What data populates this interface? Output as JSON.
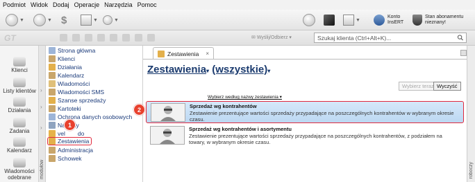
{
  "menu": [
    "Podmiot",
    "Widok",
    "Dodaj",
    "Operacje",
    "Narzędzia",
    "Pomoc"
  ],
  "account": {
    "title": "Konto",
    "name": "InsERT",
    "subscription_line1": "Stan abonamentu",
    "subscription_line2": "nieznany!"
  },
  "subbar": {
    "logo": "GT",
    "send_label": "Wyślij/Odbierz",
    "search_placeholder": "Szukaj klienta (Ctrl+Alt+K)..."
  },
  "left_nav": [
    {
      "label": "Klienci",
      "icon": "clients-icon"
    },
    {
      "label": "Listy klientów",
      "icon": "client-lists-icon"
    },
    {
      "label": "Działania",
      "icon": "actions-icon"
    },
    {
      "label": "Zadania",
      "icon": "tasks-icon"
    },
    {
      "label": "Kalendarz",
      "icon": "calendar-icon"
    },
    {
      "label": "Wiadomości odebrane",
      "icon": "inbox-icon"
    }
  ],
  "module_strip_label": "modułów",
  "right_strip_label": "roboczy",
  "tree": [
    {
      "label": "Strona główna",
      "color": "#9db5d8"
    },
    {
      "label": "Klienci",
      "color": "#c9a66b"
    },
    {
      "label": "Działania",
      "color": "#e3b04b"
    },
    {
      "label": "Kalendarz",
      "color": "#c9a66b"
    },
    {
      "label": "Wiadomości",
      "color": "#e0c07a"
    },
    {
      "label": "Wiadomości SMS",
      "color": "#c9a66b"
    },
    {
      "label": "Szanse sprzedaży",
      "color": "#e3b04b"
    },
    {
      "label": "Kartoteki",
      "color": "#c9a66b"
    },
    {
      "label": "Ochrona danych osobowych",
      "color": "#9db5d8"
    },
    {
      "label": "Nakłady",
      "color": "#8fa4c0"
    },
    {
      "label": "vel",
      "suffix": "do",
      "color": "#e6b24a"
    },
    {
      "label": "Zestawienia",
      "color": "#e3b04b"
    },
    {
      "label": "Administracja",
      "color": "#c9a66b"
    },
    {
      "label": "Schowek",
      "color": "#c9a66b"
    }
  ],
  "tab": {
    "label": "Zestawienia",
    "close": "×"
  },
  "heading": {
    "title": "Zestawienia",
    "filter": "(wszystkie)"
  },
  "buttons": {
    "select_now": "Wybierz teraz",
    "clear": "Wyczyść"
  },
  "sort_link": "Wybierz według nazwy zestawienia",
  "reports": [
    {
      "title": "Sprzedaż wg kontrahentów",
      "description": "Zestawienie prezentujące wartości sprzedaży przypadające na poszczególnych kontrahentów w wybranym okresie czasu."
    },
    {
      "title": "Sprzedaż wg kontrahentów i asortymentu",
      "description": "Zestawienie prezentujące wartości sprzedaży przypadające na poszczególnych kontrahentów, z podziałem na towary, w wybranym okresie czasu."
    }
  ],
  "badges": [
    "1",
    "2"
  ],
  "colors": {
    "highlight": "#e0283c",
    "selection": "#cfe3f7",
    "heading": "#1b3b6f"
  }
}
